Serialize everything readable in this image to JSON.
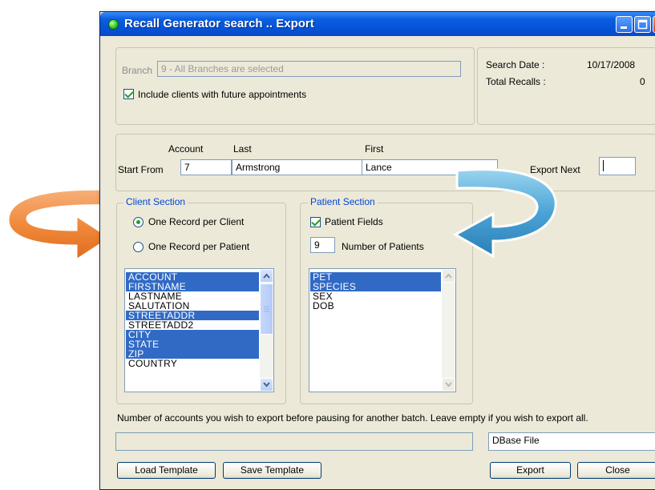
{
  "window": {
    "title": "Recall Generator search .. Export"
  },
  "branch": {
    "label": "Branch",
    "value": "9 - All Branches are selected"
  },
  "include_future": {
    "label": "Include clients with future appointments",
    "checked": true
  },
  "summary": {
    "search_date_label": "Search Date :",
    "search_date_value": "10/17/2008",
    "total_recalls_label": "Total Recalls :",
    "total_recalls_value": "0"
  },
  "start_from": {
    "label": "Start From",
    "account_header": "Account",
    "last_header": "Last",
    "first_header": "First",
    "account": "7",
    "last": "Armstrong",
    "first": "Lance"
  },
  "export_next": {
    "label": "Export Next",
    "value": ""
  },
  "client_section": {
    "title": "Client Section",
    "option_client": "One Record per Client",
    "option_patient": "One Record per Patient",
    "selected": "client",
    "fields": [
      {
        "name": "ACCOUNT",
        "selected": true
      },
      {
        "name": "FIRSTNAME",
        "selected": true
      },
      {
        "name": "LASTNAME",
        "selected": false
      },
      {
        "name": "SALUTATION",
        "selected": false
      },
      {
        "name": "STREETADDR",
        "selected": true
      },
      {
        "name": "STREETADD2",
        "selected": false
      },
      {
        "name": "CITY",
        "selected": true
      },
      {
        "name": "STATE",
        "selected": true
      },
      {
        "name": "ZIP",
        "selected": true
      },
      {
        "name": "COUNTRY",
        "selected": false
      }
    ]
  },
  "patient_section": {
    "title": "Patient Section",
    "patient_fields_label": "Patient Fields",
    "patient_fields_checked": true,
    "num_patients_value": "9",
    "num_patients_label": "Number of Patients",
    "fields": [
      {
        "name": "PET",
        "selected": true
      },
      {
        "name": "SPECIES",
        "selected": true
      },
      {
        "name": "SEX",
        "selected": false
      },
      {
        "name": "DOB",
        "selected": false
      }
    ]
  },
  "hint": "Number of accounts you wish to export before pausing for another batch. Leave empty if you wish to export all.",
  "format": {
    "value": "DBase File"
  },
  "buttons": {
    "load_template": "Load Template",
    "save_template": "Save Template",
    "export": "Export",
    "close": "Close"
  },
  "colors": {
    "arrow_left": "#f08a3c",
    "arrow_right": "#4aa3d6",
    "selection": "#316ac5",
    "title_bar": "#0553d6"
  }
}
